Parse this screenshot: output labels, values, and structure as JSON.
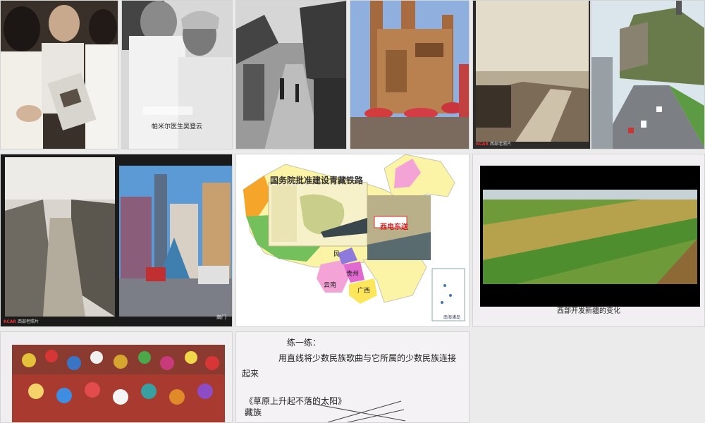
{
  "slides": {
    "doctor": {
      "caption": "帕米尔医生吴登云"
    },
    "old_city_1": {
      "watermark_brand": "KCAR",
      "watermark_text": "西部老照片"
    },
    "old_city_2": {
      "watermark_brand": "KCAR",
      "watermark_text": "西部老照片",
      "caption": "南门"
    },
    "map": {
      "title": "国务院批准建设青藏铁路",
      "banner": "西电东送",
      "labels": {
        "yunnan": "云南",
        "guizhou": "贵州",
        "guangxi": "广西",
        "min": "民",
        "sea": "南海诸岛"
      }
    },
    "west": {
      "caption": "西部开发新疆的变化"
    },
    "exercise": {
      "title": "练一练：",
      "instruction": "用直线将少数民族歌曲与它所属的少数民族连接起来",
      "song": "《草原上升起不落的太阳》",
      "ethnic": "藏族"
    }
  },
  "colors": {
    "background": "#ebebeb",
    "map_pink": "#f4a3d6",
    "map_yellow": "#fbf4a6",
    "map_green": "#74c05c",
    "map_orange": "#f6a52b"
  }
}
